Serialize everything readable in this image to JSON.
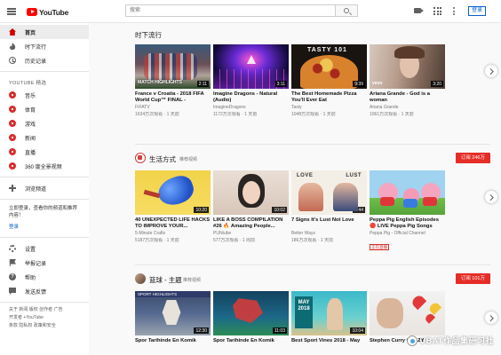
{
  "header": {
    "logo_text": "YouTube",
    "search_placeholder": "搜索",
    "login_label": "登录",
    "icons": [
      "menu-icon",
      "youtube-logo",
      "search-icon",
      "video-camera-icon",
      "apps-grid-icon",
      "more-vertical-icon"
    ]
  },
  "sidebar": {
    "primary": [
      {
        "label": "首页",
        "icon": "home-icon",
        "active": true
      },
      {
        "label": "时下流行",
        "icon": "trending-icon"
      },
      {
        "label": "历史记录",
        "icon": "history-icon"
      }
    ],
    "best_heading": "YOUTUBE 精选",
    "best": [
      {
        "label": "音乐",
        "icon": "music-icon"
      },
      {
        "label": "体育",
        "icon": "sports-icon"
      },
      {
        "label": "游戏",
        "icon": "gaming-icon"
      },
      {
        "label": "新闻",
        "icon": "news-icon"
      },
      {
        "label": "直播",
        "icon": "live-icon"
      },
      {
        "label": "360 度全景视频",
        "icon": "360-icon"
      }
    ],
    "browse_channels": "浏览频道",
    "login_prompt": "立即登录，查看你的频道和推荐内容！",
    "login_link": "登录",
    "secondary": [
      {
        "label": "设置",
        "icon": "settings-icon"
      },
      {
        "label": "举报记录",
        "icon": "flag-icon"
      },
      {
        "label": "帮助",
        "icon": "help-icon"
      },
      {
        "label": "发送反馈",
        "icon": "feedback-icon"
      }
    ],
    "footer_line1": "关于  新闻  版权  创作者  广告",
    "footer_line2": "开发者  +YouTube",
    "footer_line3": "条款  隐私权  政策和安全"
  },
  "sections": [
    {
      "title": "时下流行",
      "videos": [
        {
          "title": "France v Croatia - 2018 FIFA World Cup™ FINAL -",
          "channel": "FIFATV",
          "stats": "1634万次观看 · 1 天前",
          "duration": "2:11",
          "overlay": "MATCH HIGHLIGHTS"
        },
        {
          "title": "Imagine Dragons - Natural (Audio)",
          "channel": "ImagineDragons",
          "stats": "1172万次观看 · 1 天前",
          "duration": "3:11",
          "overlay": ""
        },
        {
          "title": "The Best Homemade Pizza You'll Ever Eat",
          "channel": "Tasty",
          "stats": "1048万次观看 · 1 天前",
          "duration": "9:39",
          "overlay": "TASTY 101"
        },
        {
          "title": "Ariana Grande - God is a woman",
          "channel": "Ariana Grande",
          "stats": "1061万次观看 · 1 天前",
          "duration": "3:20",
          "overlay": "vevo"
        }
      ]
    },
    {
      "title": "生活方式",
      "subtitle": "推荐视频",
      "subscribe_label": "订阅 246万",
      "videos": [
        {
          "title": "40 UNEXPECTED LIFE HACKS TO IMPROVE YOUR...",
          "channel": "5-Minute Crafts",
          "stats": "5187万次观看 · 1 天前",
          "duration": "10:20",
          "overlay": ""
        },
        {
          "title": "LIKE A BOSS COMPILATION #26 🔥 Amazing People...",
          "channel": "PUNtube",
          "stats": "577万次观看 · 1 周前",
          "duration": "10:02",
          "overlay": ""
        },
        {
          "title": "7 Signs It's Lust Not Love",
          "channel": "Better Ways",
          "stats": "186万次观看 · 1 天前",
          "duration": "6:44",
          "overlay_left": "LOVE",
          "overlay_right": "LUST"
        },
        {
          "title": "Peppa Pig English Episodes 🔴 LIVE Peppa Pig Songs",
          "channel": "Peppa Pig - Official Channel",
          "stats": "",
          "duration": "",
          "badge": "正在直播"
        }
      ]
    },
    {
      "title": "篮球 - 主题",
      "subtitle": "推荐视频",
      "subscribe_label": "订阅 101万",
      "videos": [
        {
          "title": "Spor Tarihinde En Komik",
          "duration": "12:30",
          "overlay": "SPORT HIGHLIGHTS"
        },
        {
          "title": "Spor Tarihinde En Komik",
          "duration": "11:03",
          "overlay": ""
        },
        {
          "title": "Best Sport Vines 2018 - May",
          "duration": "10:04",
          "overlay": "MAY 2018"
        },
        {
          "title": "Stephen Curry CRAZY",
          "duration": "",
          "overlay": ""
        }
      ]
    }
  ],
  "watermark": "UBAT作品集研习社",
  "colors": {
    "brand_red": "#ff0000",
    "subscribe_red": "#e52d27",
    "link_blue": "#065fd4"
  }
}
